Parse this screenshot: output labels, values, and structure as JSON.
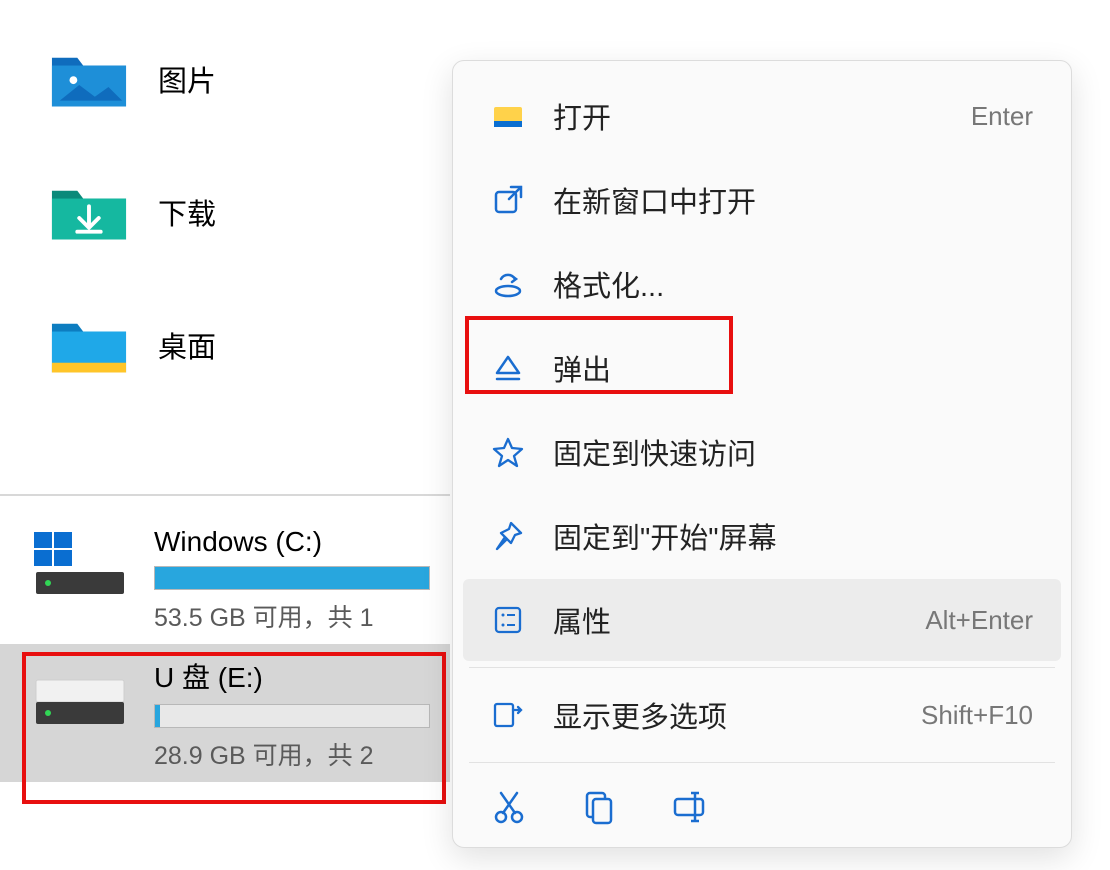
{
  "sidebar": {
    "folders": [
      {
        "label": "图片",
        "icon": "pictures-icon"
      },
      {
        "label": "下载",
        "icon": "downloads-icon"
      },
      {
        "label": "桌面",
        "icon": "desktop-icon"
      }
    ]
  },
  "drives": [
    {
      "name": "Windows (C:)",
      "free": "53.5 GB 可用，共 1",
      "fill_percent": 100,
      "selected": false
    },
    {
      "name": "U 盘 (E:)",
      "free": "28.9 GB 可用，共 2",
      "fill_percent": 0,
      "selected": true
    }
  ],
  "context_menu": {
    "items": [
      {
        "icon": "folder-open-icon",
        "label": "打开",
        "shortcut": "Enter"
      },
      {
        "icon": "external-link-icon",
        "label": "在新窗口中打开",
        "shortcut": ""
      },
      {
        "icon": "format-icon",
        "label": "格式化...",
        "shortcut": ""
      },
      {
        "icon": "eject-icon",
        "label": "弹出",
        "shortcut": "",
        "highlighted": true
      },
      {
        "icon": "star-icon",
        "label": "固定到快速访问",
        "shortcut": ""
      },
      {
        "icon": "pin-icon",
        "label": "固定到\"开始\"屏幕",
        "shortcut": ""
      },
      {
        "icon": "properties-icon",
        "label": "属性",
        "shortcut": "Alt+Enter",
        "hover": true
      },
      {
        "icon": "more-icon",
        "label": "显示更多选项",
        "shortcut": "Shift+F10"
      }
    ],
    "toolbar": [
      {
        "icon": "cut-icon"
      },
      {
        "icon": "copy-icon"
      },
      {
        "icon": "rename-icon"
      }
    ]
  }
}
